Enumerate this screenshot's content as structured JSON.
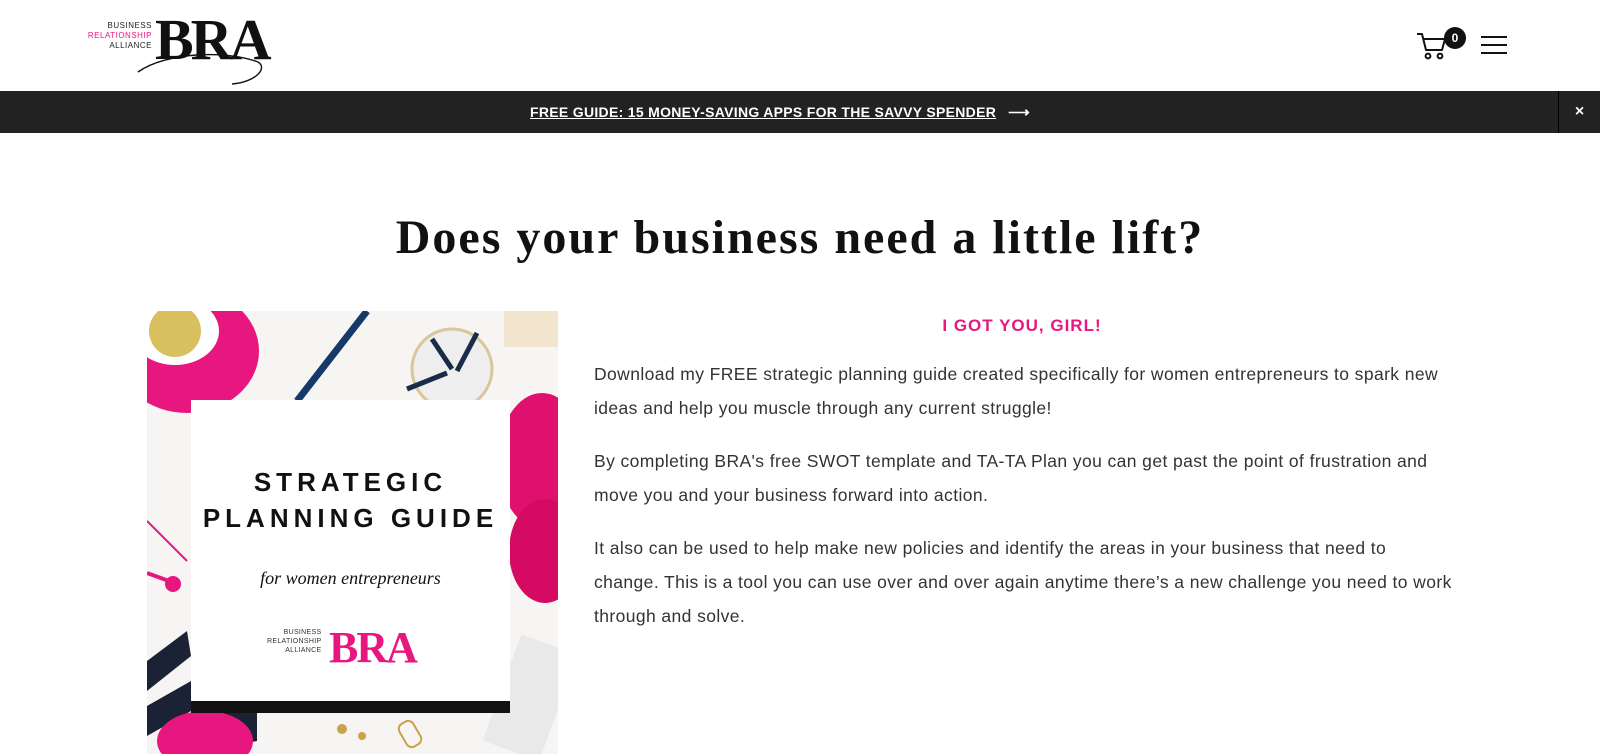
{
  "header": {
    "logo": {
      "line1": "BUSINESS",
      "line2": "RELATIONSHIP",
      "line3": "ALLIANCE",
      "mark": "BRA"
    },
    "cart_count": "0",
    "cart_icon": "cart-icon",
    "menu_icon": "hamburger-menu-icon"
  },
  "announcement": {
    "text": "FREE GUIDE: 15 MONEY-SAVING APPS FOR THE SAVVY SPENDER",
    "arrow": "⟶",
    "close": "×"
  },
  "main": {
    "headline": "Does your business need a little lift?",
    "guide": {
      "title": "STRATEGIC PLANNING GUIDE",
      "subtitle": "for women entrepreneurs",
      "logo_line1": "BUSINESS",
      "logo_line2": "RELATIONSHIP",
      "logo_line3": "ALLIANCE",
      "logo_mark": "BRA"
    },
    "intro_heading": "I GOT YOU, GIRL!",
    "paragraphs": [
      "Download my FREE strategic planning guide created specifically for women entrepreneurs to spark new ideas and help you muscle through any current struggle!",
      "By completing BRA's free SWOT template and TA-TA Plan you can get past the point of frustration and move you and your business forward into action.",
      "It also can be used to help make new policies and identify the areas in your business that need to change. This is a tool you can use over and over again anytime there’s a new challenge you need to work through and solve."
    ]
  },
  "colors": {
    "accent_pink": "#e8177f",
    "bar_dark": "#222222"
  }
}
